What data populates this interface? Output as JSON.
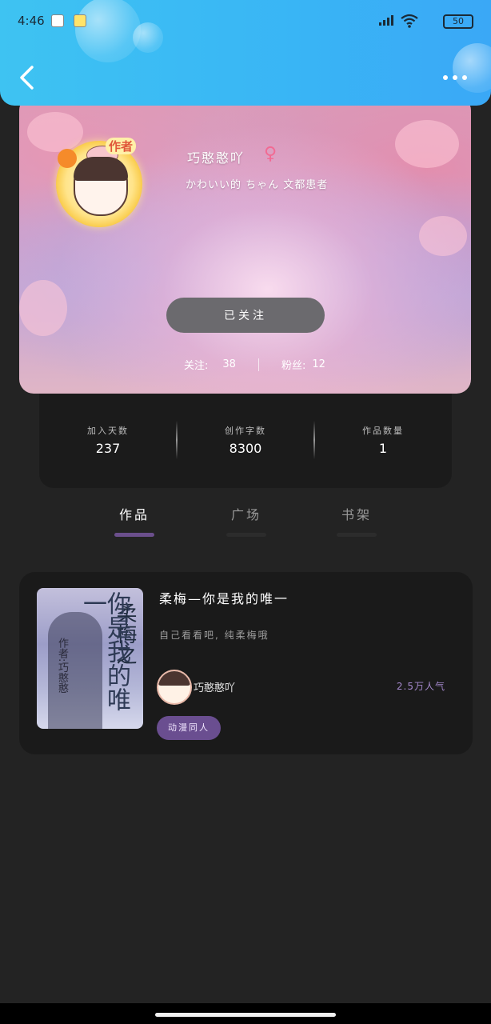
{
  "status_bar": {
    "time": "4:46",
    "battery": "50"
  },
  "header": {
    "back_icon": "chevron-left-icon",
    "more_icon": "more-dots-icon"
  },
  "profile": {
    "badge": "作者",
    "username": "巧憨憨吖",
    "gender_symbol": "♀",
    "bio": "かわいい的 ちゃん 文都患者",
    "follow_label": "已关注",
    "follow_count_label": "关注:",
    "follow_count": "38",
    "fans_label": "粉丝:",
    "fans_count": "12"
  },
  "stats": [
    {
      "label": "加入天数",
      "value": "237"
    },
    {
      "label": "创作字数",
      "value": "8300"
    },
    {
      "label": "作品数量",
      "value": "1"
    }
  ],
  "tabs": [
    {
      "label": "作品",
      "active": true
    },
    {
      "label": "广场",
      "active": false
    },
    {
      "label": "书架",
      "active": false
    }
  ],
  "work": {
    "title": "柔梅—你是我的唯一",
    "description": "自己看看吧, 纯柔梅哦",
    "author": "巧憨憨吖",
    "popularity": "2.5万人气",
    "tag": "动漫同人",
    "cover_text_main": "柔梅之",
    "cover_text_sub": "你是我的唯一",
    "cover_text_author": "作者:巧憨憨"
  },
  "colors": {
    "header_blue": "#3ab6f5",
    "accent_purple": "#6a4e90",
    "background": "#232323"
  }
}
